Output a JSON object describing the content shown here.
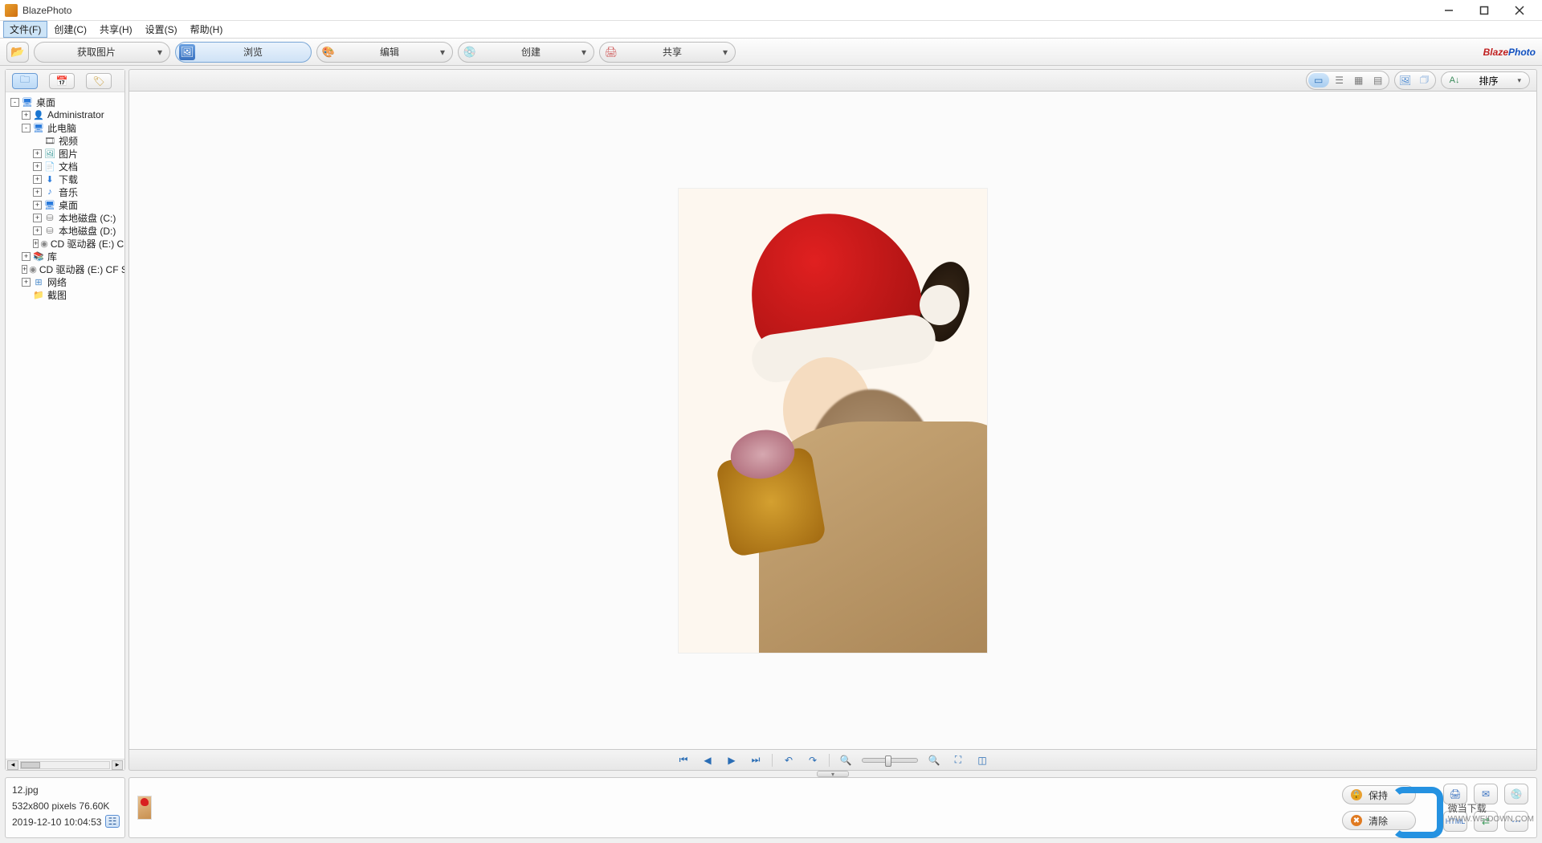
{
  "app": {
    "title": "BlazePhoto"
  },
  "menu": {
    "file": "文件(F)",
    "create": "创建(C)",
    "share": "共享(H)",
    "settings": "设置(S)",
    "help": "帮助(H)"
  },
  "toolbar": {
    "acquire": "获取图片",
    "browse": "浏览",
    "edit": "编辑",
    "create": "创建",
    "share": "共享",
    "brand1": "Blaze",
    "brand2": "Photo"
  },
  "view_toolbar": {
    "sort_label": "排序"
  },
  "tree": [
    {
      "depth": 0,
      "expand": "-",
      "icon": "🖥",
      "iconColor": "#2a7bdc",
      "label": "桌面"
    },
    {
      "depth": 1,
      "expand": "+",
      "icon": "👤",
      "iconColor": "#5a8a3a",
      "label": "Administrator"
    },
    {
      "depth": 1,
      "expand": "-",
      "icon": "🖥",
      "iconColor": "#2a7bdc",
      "label": "此电脑"
    },
    {
      "depth": 2,
      "expand": "",
      "icon": "🎞",
      "iconColor": "#555",
      "label": "视频"
    },
    {
      "depth": 2,
      "expand": "+",
      "icon": "🖼",
      "iconColor": "#3a9a9a",
      "label": "图片"
    },
    {
      "depth": 2,
      "expand": "+",
      "icon": "📄",
      "iconColor": "#777",
      "label": "文档"
    },
    {
      "depth": 2,
      "expand": "+",
      "icon": "⬇",
      "iconColor": "#2a7bdc",
      "label": "下载"
    },
    {
      "depth": 2,
      "expand": "+",
      "icon": "♪",
      "iconColor": "#2a7bdc",
      "label": "音乐"
    },
    {
      "depth": 2,
      "expand": "+",
      "icon": "🖥",
      "iconColor": "#2a7bdc",
      "label": "桌面"
    },
    {
      "depth": 2,
      "expand": "+",
      "icon": "⛁",
      "iconColor": "#777",
      "label": "本地磁盘 (C:)"
    },
    {
      "depth": 2,
      "expand": "+",
      "icon": "⛁",
      "iconColor": "#777",
      "label": "本地磁盘 (D:)"
    },
    {
      "depth": 2,
      "expand": "+",
      "icon": "◉",
      "iconColor": "#888",
      "label": "CD 驱动器 (E:) C"
    },
    {
      "depth": 1,
      "expand": "+",
      "icon": "📚",
      "iconColor": "#caa040",
      "label": "库"
    },
    {
      "depth": 1,
      "expand": "+",
      "icon": "◉",
      "iconColor": "#888",
      "label": "CD 驱动器 (E:) CF S"
    },
    {
      "depth": 1,
      "expand": "+",
      "icon": "⊞",
      "iconColor": "#4a8aca",
      "label": "网络"
    },
    {
      "depth": 1,
      "expand": "",
      "icon": "📁",
      "iconColor": "#e8c060",
      "label": "截图"
    }
  ],
  "info": {
    "filename": "12.jpg",
    "dimensions": "532x800 pixels  76.60K",
    "datetime": "2019-12-10 10:04:53"
  },
  "tray": {
    "keep": "保持",
    "clear": "清除"
  },
  "watermark": {
    "title": "微当下载",
    "url": "WWW.WEIDOWN.COM"
  }
}
